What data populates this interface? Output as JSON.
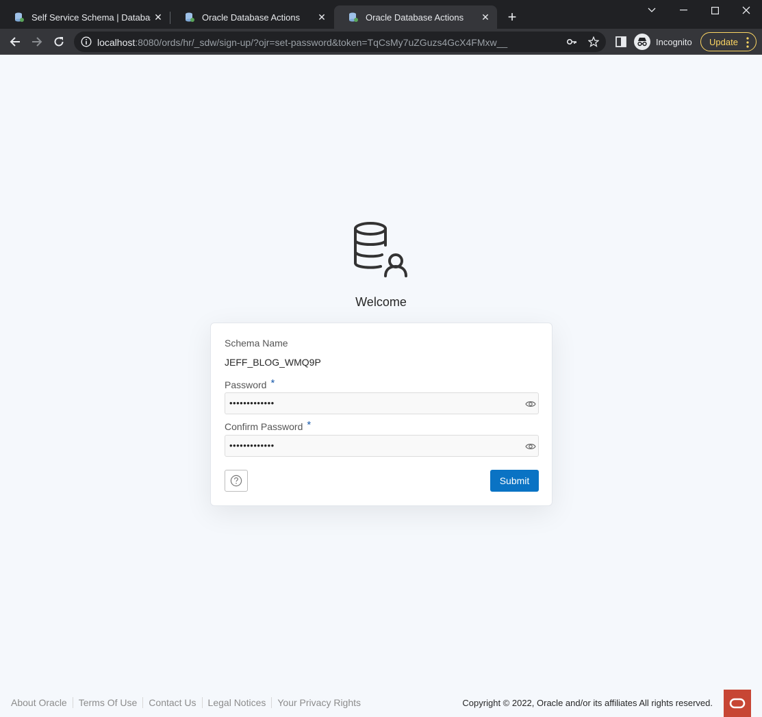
{
  "browser": {
    "tabs": [
      {
        "title": "Self Service Schema | Database U",
        "active": false
      },
      {
        "title": "Oracle Database Actions",
        "active": false
      },
      {
        "title": "Oracle Database Actions",
        "active": true
      }
    ],
    "url_host": "localhost",
    "url_rest": ":8080/ords/hr/_sdw/sign-up/?ojr=set-password&token=TqCsMy7uZGuzs4GcX4FMxw__",
    "incognito_label": "Incognito",
    "update_label": "Update"
  },
  "page": {
    "welcome": "Welcome",
    "form": {
      "schema_label": "Schema Name",
      "schema_value": "JEFF_BLOG_WMQ9P",
      "password_label": "Password",
      "password_mask": "•••••••••••••",
      "confirm_label": "Confirm Password",
      "confirm_mask": "•••••••••••••",
      "required_mark": "*",
      "submit_label": "Submit"
    },
    "footer": {
      "links": [
        "About Oracle",
        "Terms Of Use",
        "Contact Us",
        "Legal Notices",
        "Your Privacy Rights"
      ],
      "copyright": "Copyright © 2022, Oracle and/or its affiliates All rights reserved."
    }
  },
  "colors": {
    "accent": "#0a73c4",
    "oracle_red": "#c74634",
    "required": "#1a5bab",
    "update_yellow": "#fdd663"
  },
  "icons": [
    "database-user-icon",
    "eye-icon",
    "help-icon",
    "oracle-logo-icon",
    "incognito-icon",
    "key-icon",
    "star-icon",
    "sidepanel-icon",
    "info-icon"
  ]
}
